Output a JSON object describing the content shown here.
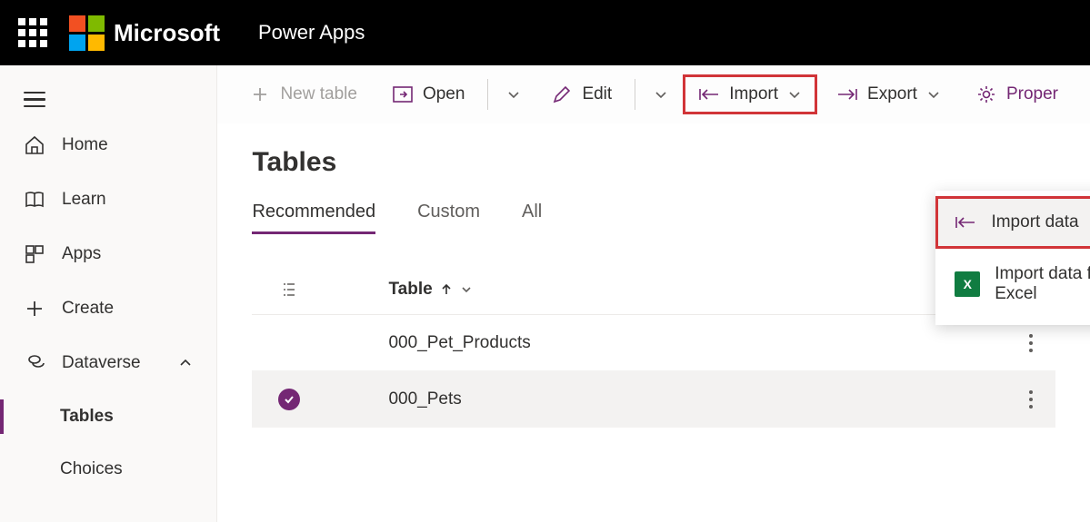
{
  "header": {
    "brand": "Microsoft",
    "app": "Power Apps"
  },
  "sidebar": {
    "items": [
      {
        "label": "Home"
      },
      {
        "label": "Learn"
      },
      {
        "label": "Apps"
      },
      {
        "label": "Create"
      },
      {
        "label": "Dataverse"
      },
      {
        "label": "Tables"
      },
      {
        "label": "Choices"
      }
    ]
  },
  "commands": {
    "newTable": "New table",
    "open": "Open",
    "edit": "Edit",
    "import": "Import",
    "export": "Export",
    "properties": "Proper"
  },
  "dropdown": {
    "items": [
      {
        "label": "Import data"
      },
      {
        "label": "Import data from Excel"
      }
    ]
  },
  "page": {
    "title": "Tables",
    "tabs": [
      {
        "label": "Recommended"
      },
      {
        "label": "Custom"
      },
      {
        "label": "All"
      }
    ],
    "columnHeader": "Table",
    "rows": [
      {
        "name": "000_Pet_Products",
        "selected": false
      },
      {
        "name": "000_Pets",
        "selected": true
      }
    ]
  }
}
